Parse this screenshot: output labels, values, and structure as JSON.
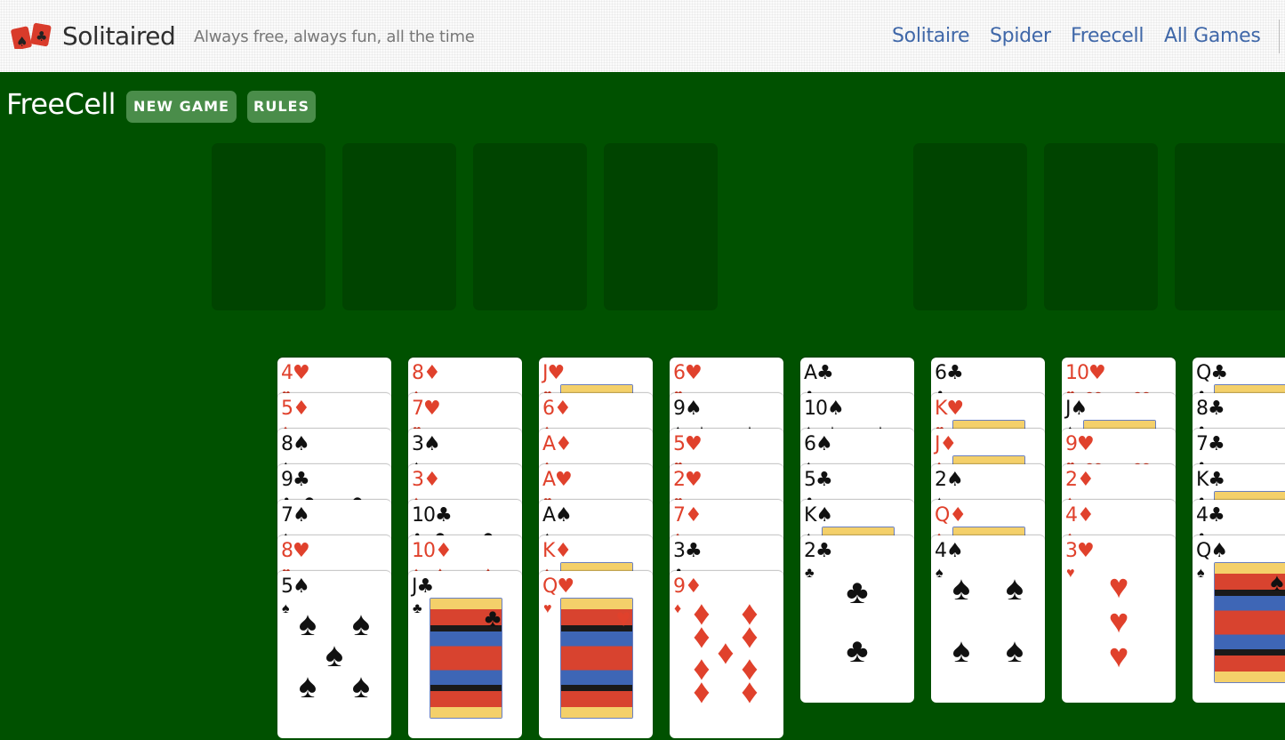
{
  "header": {
    "brand": "Solitaired",
    "tagline": "Always free, always fun, all the time",
    "nav": [
      "Solitaire",
      "Spider",
      "Freecell",
      "All Games"
    ]
  },
  "toolbar": {
    "title": "FreeCell",
    "new_game_label": "NEW GAME",
    "rules_label": "RULES"
  },
  "slots": {
    "free_cells": 4,
    "foundations": 3
  },
  "colors": {
    "felt": "#005100",
    "slot": "#004400",
    "button": "#4a8d4a",
    "red_suit": "#e0412c",
    "black_suit": "#111111",
    "nav_link": "#3f67a8"
  },
  "tableau": [
    [
      "4♥",
      "5♦",
      "8♠",
      "9♣",
      "7♠",
      "8♥",
      "5♠"
    ],
    [
      "8♦",
      "7♥",
      "3♠",
      "3♦",
      "10♣",
      "10♦",
      "J♣"
    ],
    [
      "J♥",
      "6♦",
      "A♦",
      "A♥",
      "A♠",
      "K♦",
      "Q♥"
    ],
    [
      "6♥",
      "9♠",
      "5♥",
      "2♥",
      "7♦",
      "3♣",
      "9♦"
    ],
    [
      "A♣",
      "10♠",
      "6♠",
      "5♣",
      "K♠",
      "2♣"
    ],
    [
      "6♣",
      "K♥",
      "J♦",
      "2♠",
      "Q♦",
      "4♠"
    ],
    [
      "10♥",
      "J♠",
      "9♥",
      "2♦",
      "4♦",
      "3♥"
    ],
    [
      "Q♣",
      "8♣",
      "7♣",
      "K♣",
      "4♣",
      "Q♠"
    ]
  ]
}
